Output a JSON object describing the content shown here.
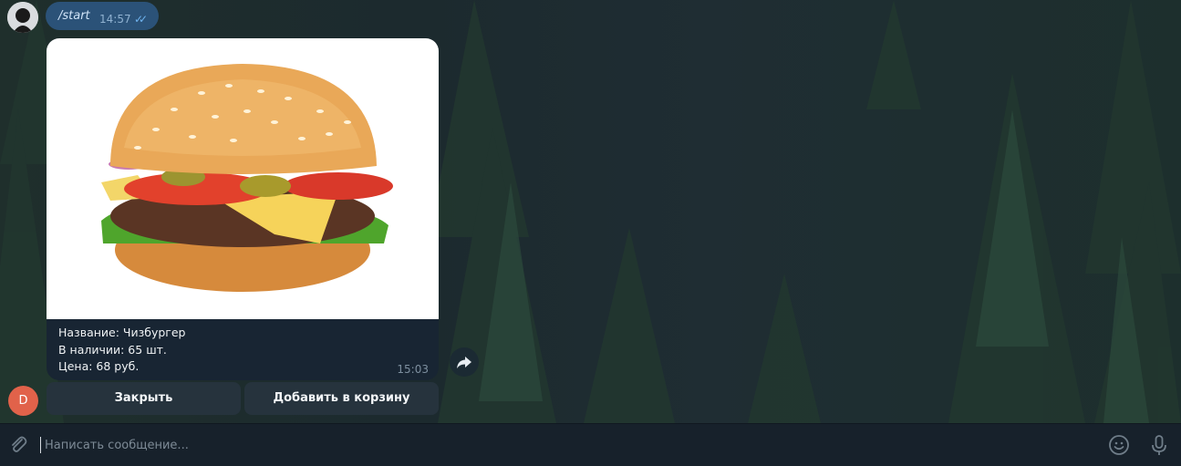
{
  "chat": {
    "outgoing_message": {
      "text": "/start",
      "time": "14:57"
    },
    "product_card": {
      "caption_name": "Название: Чизбургер",
      "caption_stock": "В наличии: 65 шт.",
      "caption_price": "Цена: 68 руб.",
      "time": "15:03",
      "image_icon": "cheeseburger-photo"
    },
    "bot_avatar_letter": "D",
    "inline_keyboard": {
      "close_label": "Закрыть",
      "add_to_cart_label": "Добавить в корзину"
    }
  },
  "composer": {
    "placeholder": "Написать сообщение...",
    "icons": [
      "paperclip-icon",
      "emoji-icon",
      "microphone-icon"
    ]
  },
  "colors": {
    "outgoing_bubble": "#2b5278",
    "card_bg": "#182533",
    "keyboard_button": "#26333d",
    "composer_bg": "#17212b",
    "bot_avatar": "#e1624a"
  }
}
